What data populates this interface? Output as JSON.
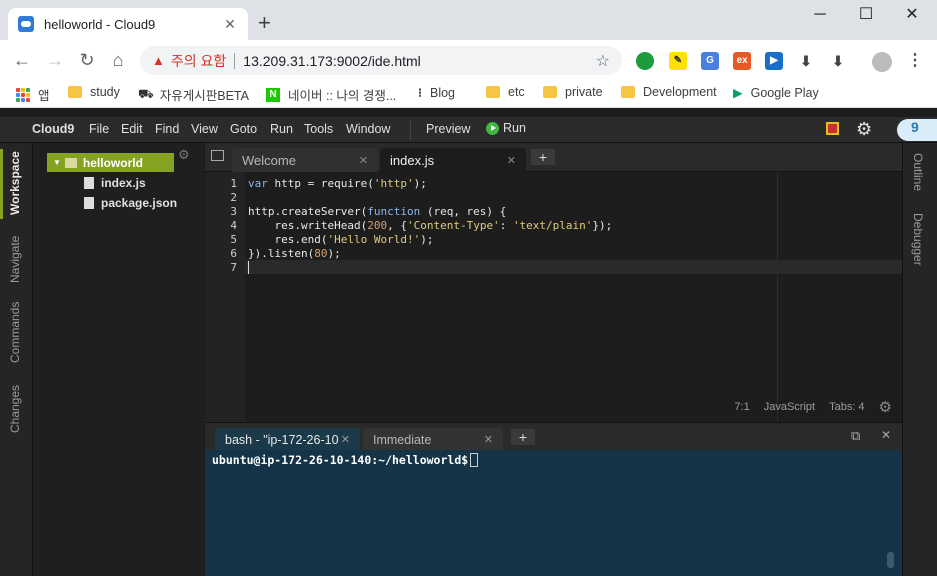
{
  "browser": {
    "tab_title": "helloworld - Cloud9",
    "tab_close": "✕",
    "new_tab": "+",
    "window_min": "─",
    "window_max": "☐",
    "window_close": "✕",
    "security_warning": "주의 요함",
    "url": "13.209.31.173:9002/ide.html",
    "bookmarks": [
      {
        "label": "앱",
        "icon": "apps-icon"
      },
      {
        "label": "study",
        "icon": "folder-icon"
      },
      {
        "label": "자유게시판BETA",
        "icon": "board-icon"
      },
      {
        "label": "네이버 :: 나의 경쟁...",
        "icon": "naver-icon"
      },
      {
        "label": "Blog",
        "icon": "blog-icon"
      },
      {
        "label": "etc",
        "icon": "folder-icon"
      },
      {
        "label": "private",
        "icon": "folder-icon"
      },
      {
        "label": "Development",
        "icon": "folder-icon"
      },
      {
        "label": "Google Play",
        "icon": "google-play-icon"
      }
    ]
  },
  "ide": {
    "brand": "Cloud9",
    "menu": [
      "File",
      "Edit",
      "Find",
      "View",
      "Goto",
      "Run",
      "Tools",
      "Window"
    ],
    "preview": "Preview",
    "run": "Run",
    "left_panels": [
      "Workspace",
      "Navigate",
      "Commands",
      "Changes"
    ],
    "right_panels": [
      "Outline",
      "Debugger"
    ],
    "tree": {
      "root": "helloworld",
      "files": [
        "index.js",
        "package.json"
      ]
    },
    "editor_tabs": [
      {
        "label": "Welcome",
        "active": false
      },
      {
        "label": "index.js",
        "active": true
      }
    ],
    "code_lines": [
      "var http = require('http');",
      "",
      "http.createServer(function (req, res) {",
      "    res.writeHead(200, {'Content-Type': 'text/plain'});",
      "    res.end('Hello World!');",
      "}).listen(80);",
      ""
    ],
    "line_numbers": [
      "1",
      "2",
      "3",
      "4",
      "5",
      "6",
      "7"
    ],
    "status": {
      "position": "7:1",
      "language": "JavaScript",
      "tabs": "Tabs: 4"
    },
    "terminal_tabs": [
      {
        "label": "bash - \"ip-172-26-10",
        "active": true
      },
      {
        "label": "Immediate",
        "active": false
      }
    ],
    "terminal_prompt": "ubuntu@ip-172-26-10-140:~/helloworld$"
  },
  "colors": {
    "tree_selected": "#86a222",
    "terminal_bg": "#153448",
    "run_green": "#3fb63f"
  }
}
